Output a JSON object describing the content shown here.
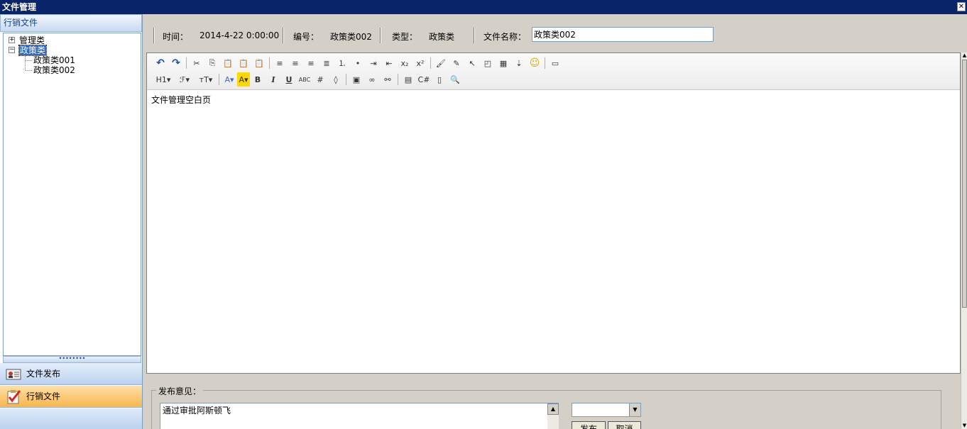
{
  "window": {
    "title": "文件管理",
    "close_glyph": "✕"
  },
  "left_panel": {
    "header": "行销文件",
    "tree": [
      {
        "label": "管理类",
        "toggle": "+",
        "selected": false,
        "children": []
      },
      {
        "label": "政策类",
        "toggle": "−",
        "selected": true,
        "children": [
          "政策类001",
          "政策类002"
        ]
      }
    ],
    "splitter_glyph": "••••••••",
    "nav": [
      {
        "label": "文件发布",
        "icon": "user-card-icon",
        "active": false
      },
      {
        "label": "行销文件",
        "icon": "checklist-icon",
        "active": true
      }
    ]
  },
  "info": {
    "time_label": "时间：",
    "time_value": "2014-4-22 0:00:00",
    "code_label": "编号：",
    "code_value": "政策类002",
    "type_label": "类型：",
    "type_value": "政策类",
    "name_label": "文件名称：",
    "name_value": "政策类002"
  },
  "editor": {
    "toolbar_row1": [
      "undo-icon",
      "redo-icon",
      "|",
      "cut-icon",
      "copy-icon",
      "paste-icon",
      "paste-text-icon",
      "paste-word-icon",
      "|",
      "align-left-icon",
      "align-center-icon",
      "align-right-icon",
      "align-justify-icon",
      "ordered-list-icon",
      "unordered-list-icon",
      "indent-icon",
      "outdent-icon",
      "subscript-icon",
      "superscript-icon",
      "|",
      "format-brush-icon",
      "clear-format-icon",
      "select-icon",
      "image-map-icon",
      "table-icon",
      "insert-line-icon",
      "emoticon-icon",
      "|",
      "pagebreak-icon"
    ],
    "toolbar_row2": [
      "heading-icon",
      "font-family-icon",
      "font-size-icon",
      "|",
      "font-color-icon",
      "highlight-icon",
      "bold-icon",
      "italic-icon",
      "underline-icon",
      "strikethrough-icon",
      "grid-icon",
      "eraser-icon",
      "|",
      "insert-image-icon",
      "link-icon",
      "unlink-icon",
      "|",
      "template-icon",
      "source-code-icon",
      "paste-icon-2",
      "preview-icon"
    ],
    "toolbar_glyphs": {
      "undo-icon": "↶",
      "redo-icon": "↷",
      "cut-icon": "✂",
      "copy-icon": "⎘",
      "paste-icon": "📋",
      "paste-text-icon": "📋",
      "paste-word-icon": "📋",
      "align-left-icon": "≡",
      "align-center-icon": "≡",
      "align-right-icon": "≡",
      "align-justify-icon": "≣",
      "ordered-list-icon": "⒈",
      "unordered-list-icon": "•",
      "indent-icon": "⇥",
      "outdent-icon": "⇤",
      "subscript-icon": "x₂",
      "superscript-icon": "x²",
      "format-brush-icon": "🖌",
      "clear-format-icon": "✎",
      "select-icon": "↖",
      "image-map-icon": "◰",
      "table-icon": "▦",
      "insert-line-icon": "⇣",
      "emoticon-icon": "☺",
      "pagebreak-icon": "▭",
      "heading-icon": "H1▾",
      "font-family-icon": "ℱ▾",
      "font-size-icon": "тT▾",
      "font-color-icon": "A▾",
      "highlight-icon": "A▾",
      "bold-icon": "B",
      "italic-icon": "I",
      "underline-icon": "U",
      "strikethrough-icon": "ABC",
      "grid-icon": "#",
      "eraser-icon": "◊",
      "insert-image-icon": "▣",
      "link-icon": "∞",
      "unlink-icon": "⚯",
      "template-icon": "▤",
      "source-code-icon": "C#",
      "paste-icon-2": "▯",
      "preview-icon": "🔍"
    },
    "content": "文件管理空白页"
  },
  "publish": {
    "legend": "发布意见：",
    "opinion": "通过审批阿斯顿飞",
    "select_value": "",
    "publish_button": "发布",
    "cancel_button": "取消"
  },
  "colors": {
    "titlebar": "#0a246a",
    "selected": "#316ac5",
    "active_nav": "#f8b64d"
  }
}
